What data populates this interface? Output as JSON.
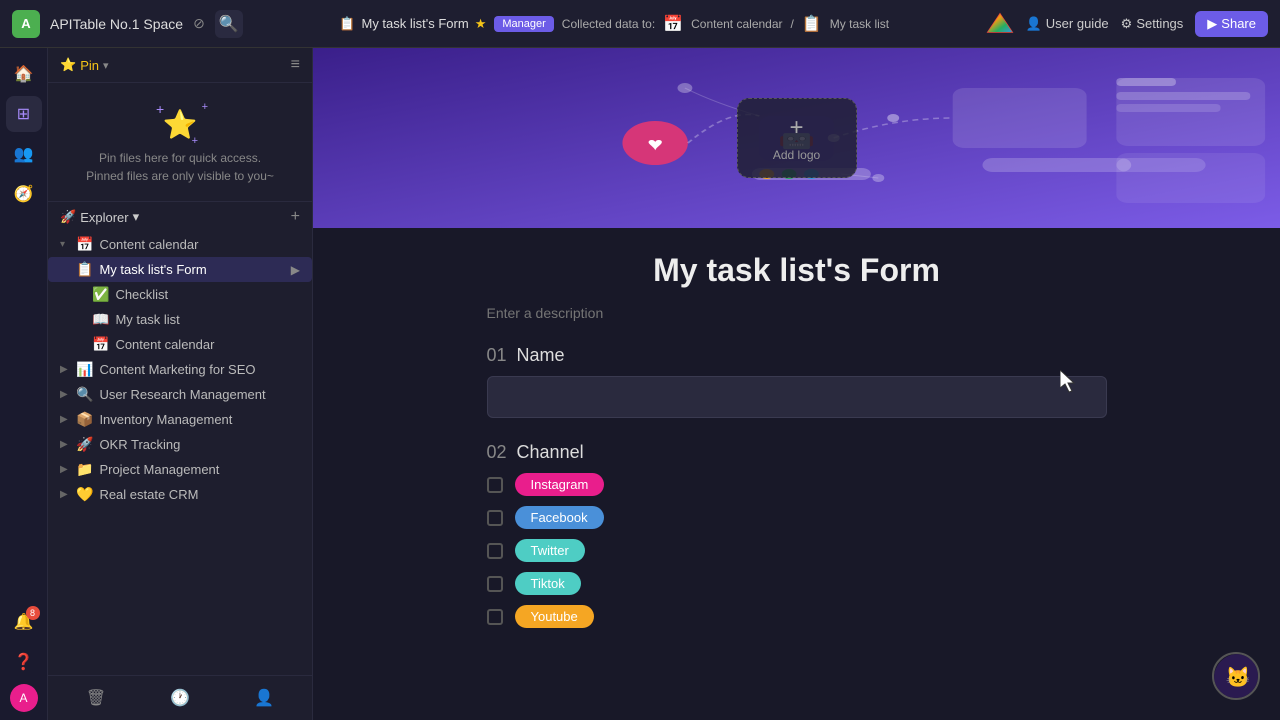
{
  "app": {
    "title": "APITable No.1 Space",
    "user_initial": "A"
  },
  "topbar": {
    "title": "APITable No.1 Space",
    "form_name": "My task list's Form",
    "badge_label": "Manager",
    "collected_label": "Collected data to:",
    "content_calendar_label": "Content calendar",
    "task_list_label": "My task list",
    "user_guide_label": "User guide",
    "settings_label": "Settings",
    "share_label": "Share"
  },
  "pin": {
    "label": "Pin",
    "placeholder_line1": "Pin files here for quick access.",
    "placeholder_line2": "Pinned files are only visible to you~"
  },
  "explorer": {
    "label": "Explorer"
  },
  "sidebar": {
    "items": [
      {
        "id": "content-calendar",
        "icon": "📅",
        "label": "Content calendar",
        "level": 0,
        "expandable": true
      },
      {
        "id": "my-task-list-form",
        "icon": "📋",
        "label": "My task list's Form",
        "level": 1,
        "active": true
      },
      {
        "id": "checklist",
        "icon": "✅",
        "label": "Checklist",
        "level": 2
      },
      {
        "id": "my-task-list",
        "icon": "📖",
        "label": "My task list",
        "level": 2
      },
      {
        "id": "content-calendar-sub",
        "icon": "📅",
        "label": "Content calendar",
        "level": 2
      },
      {
        "id": "content-marketing",
        "icon": "📊",
        "label": "Content Marketing for SEO",
        "level": 0,
        "expandable": true
      },
      {
        "id": "user-research",
        "icon": "🔍",
        "label": "User Research Management",
        "level": 0,
        "expandable": true
      },
      {
        "id": "inventory-management",
        "icon": "📦",
        "label": "Inventory Management",
        "level": 0,
        "expandable": true
      },
      {
        "id": "okr-tracking",
        "icon": "🚀",
        "label": "OKR Tracking",
        "level": 0,
        "expandable": true
      },
      {
        "id": "project-management",
        "icon": "📁",
        "label": "Project Management",
        "level": 0,
        "expandable": true
      },
      {
        "id": "real-estate-crm",
        "icon": "💛",
        "label": "Real estate CRM",
        "level": 0,
        "expandable": true
      }
    ]
  },
  "form": {
    "title": "My task list's Form",
    "description_placeholder": "Enter a description",
    "add_logo_label": "Add logo",
    "fields": [
      {
        "number": "01",
        "label": "Name",
        "type": "text",
        "placeholder": ""
      },
      {
        "number": "02",
        "label": "Channel",
        "type": "checkbox",
        "options": [
          {
            "label": "Instagram",
            "color": "instagram",
            "tag_class": "tag-instagram"
          },
          {
            "label": "Facebook",
            "color": "facebook",
            "tag_class": "tag-facebook"
          },
          {
            "label": "Twitter",
            "color": "twitter",
            "tag_class": "tag-twitter"
          },
          {
            "label": "Tiktok",
            "color": "tiktok",
            "tag_class": "tag-tiktok"
          },
          {
            "label": "Youtube",
            "color": "youtube",
            "tag_class": "tag-youtube"
          }
        ]
      }
    ]
  },
  "sidebar_icons": {
    "home": "🏠",
    "grid": "⊞",
    "users": "👥",
    "compass": "🧭",
    "bell_count": "8",
    "question": "❓",
    "avatar_color": "#4caf50"
  },
  "bottom_bar": {
    "trash": "🗑",
    "history": "🕐",
    "add_member": "👤+"
  }
}
